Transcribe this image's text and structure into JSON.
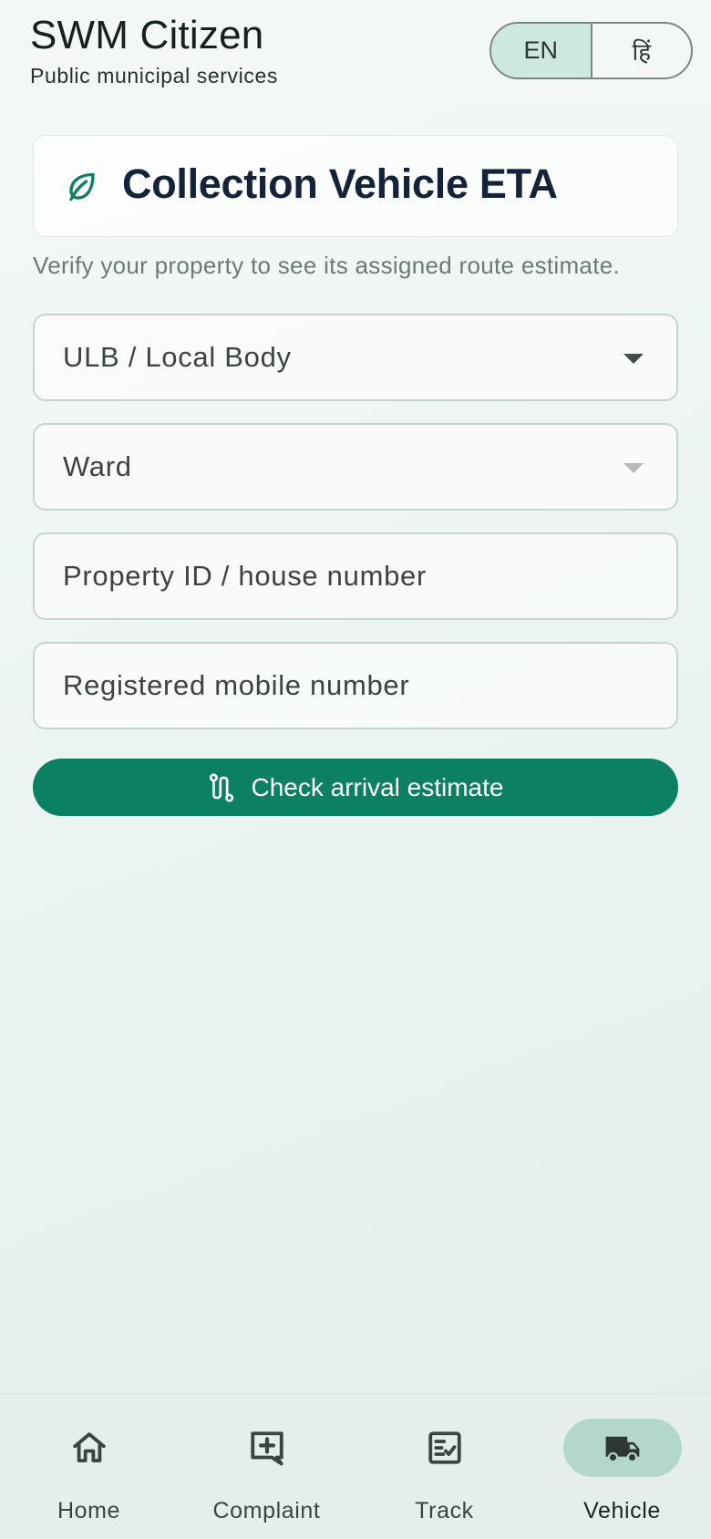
{
  "header": {
    "title": "SWM Citizen",
    "subtitle": "Public municipal services",
    "languages": [
      {
        "label": "EN",
        "active": true
      },
      {
        "label": "हिं",
        "active": false
      }
    ]
  },
  "card": {
    "icon": "leaf-icon",
    "title": "Collection Vehicle ETA",
    "helper": "Verify your property to see its assigned route estimate."
  },
  "form": {
    "ulb": {
      "label": "ULB / Local Body",
      "icon": "chevron-down-icon"
    },
    "ward": {
      "label": "Ward",
      "icon": "chevron-down-icon",
      "disabled": true
    },
    "property": {
      "placeholder": "Property ID / house number",
      "value": ""
    },
    "mobile": {
      "placeholder": "Registered mobile number",
      "value": ""
    },
    "submit": {
      "label": "Check arrival estimate",
      "icon": "route-icon"
    }
  },
  "nav": {
    "items": [
      {
        "label": "Home",
        "icon": "home-icon",
        "active": false
      },
      {
        "label": "Complaint",
        "icon": "add-comment-icon",
        "active": false
      },
      {
        "label": "Track",
        "icon": "checklist-icon",
        "active": false
      },
      {
        "label": "Vehicle",
        "icon": "truck-icon",
        "active": true
      }
    ]
  },
  "colors": {
    "primary": "#0b8063",
    "active_lang": "#cde8dc",
    "active_nav": "#b4d7cc",
    "title_text": "#14223a"
  }
}
